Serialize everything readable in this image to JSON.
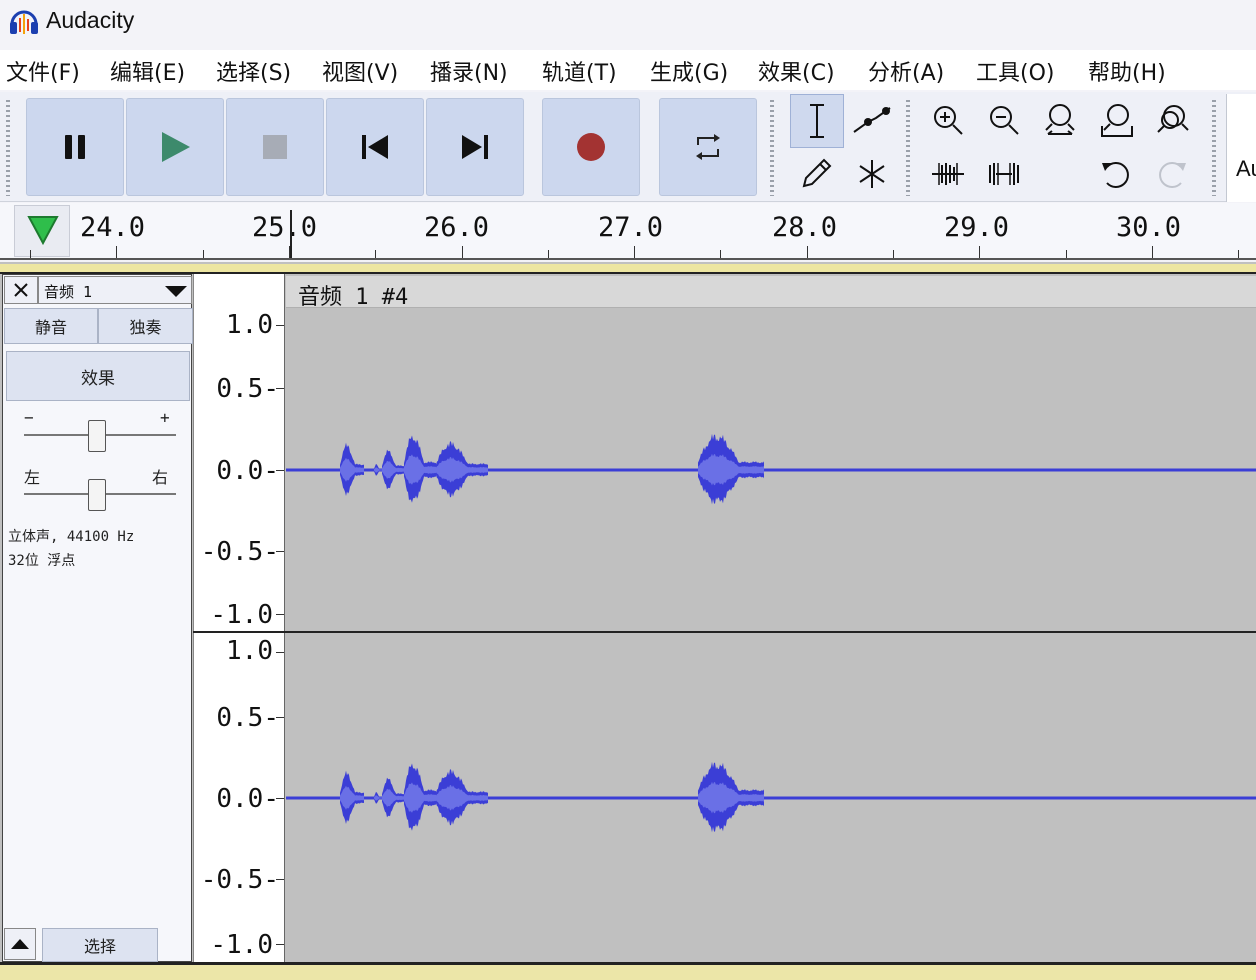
{
  "window": {
    "title": "Audacity"
  },
  "menu": [
    "文件(F)",
    "编辑(E)",
    "选择(S)",
    "视图(V)",
    "播录(N)",
    "轨道(T)",
    "生成(G)",
    "效果(C)",
    "分析(A)",
    "工具(O)",
    "帮助(H)"
  ],
  "toolbar": {
    "transport": [
      "pause",
      "play",
      "stop",
      "skip-to-start",
      "skip-to-end",
      "record",
      "loop"
    ],
    "tools": [
      "selection-tool",
      "envelope-tool",
      "draw-tool",
      "multi-tool"
    ],
    "edit_tools": [
      "zoom-in",
      "zoom-out",
      "fit-selection",
      "fit-project",
      "zoom-toggle",
      "trim-audio",
      "silence-audio",
      "undo",
      "redo"
    ],
    "cut_label": "Au"
  },
  "ruler": {
    "labels": [
      "24.0",
      "25.0",
      "26.0",
      "27.0",
      "28.0",
      "29.0",
      "30.0"
    ]
  },
  "track": {
    "name": "音频 1",
    "mute_label": "静音",
    "solo_label": "独奏",
    "effects_label": "效果",
    "gain_minus": "−",
    "gain_plus": "+",
    "pan_left": "左",
    "pan_right": "右",
    "info_line1": "立体声, 44100 Hz",
    "info_line2": "32位 浮点",
    "select_label": "选择",
    "clip_title": "音频 1 #4",
    "amplitude_labels": [
      "1.0",
      "0.5-",
      "0.0-",
      "-0.5-",
      "-1.0"
    ]
  },
  "colors": {
    "waveform": "#3b3ed6",
    "waveform_rms": "#6a70e6",
    "track_bg": "#c0c0c0",
    "record": "#a33332",
    "play": "#3d8a6c",
    "button_bg": "#ccd7ee"
  }
}
